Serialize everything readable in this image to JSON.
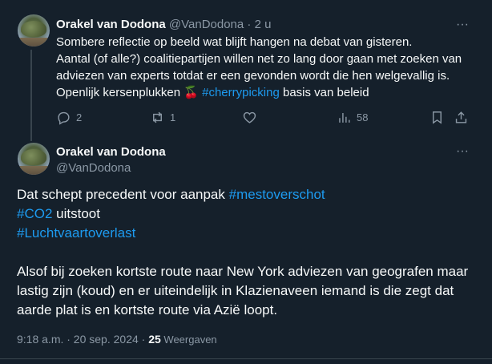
{
  "tweet1": {
    "name": "Orakel van Dodona",
    "handle": "@VanDodona",
    "separator": "·",
    "time": "2 u",
    "more_label": "···",
    "text_line1": "Sombere reflectie op beeld wat blijft hangen na debat van gisteren.",
    "text_line2": "Aantal (of alle?) coalitiepartijen willen net zo lang door gaan met zoeken van adviezen  van experts totdat er een gevonden wordt die hen welgevallig is.",
    "text_line3_pre": "Openlijk kersenplukken 🍒 ",
    "hashtag": "#cherrypicking",
    "text_line3_post": " basis van beleid",
    "replies": "2",
    "reposts": "1",
    "likes": "",
    "views": "58"
  },
  "tweet2": {
    "name": "Orakel van Dodona",
    "handle": "@VanDodona",
    "more_label": "···",
    "line1_pre": "Dat schept precedent voor aanpak ",
    "hashtag1": "#mestoverschot",
    "hashtag2": "#CO2",
    "line2_post": " uitstoot",
    "hashtag3": "#Luchtvaartoverlast",
    "paragraph2": "Alsof bij zoeken kortste route naar New York adviezen van geografen maar lastig zijn (koud) en er uiteindelijk in Klazienaveen iemand is die zegt dat aarde plat is en kortste route via Azië loopt.",
    "timestamp": "9:18 a.m. · 20 sep. 2024 · ",
    "views": "25",
    "views_label": " Weergaven"
  },
  "colors": {
    "background": "#15202b",
    "text": "#f7f9f9",
    "secondary": "#8b98a5",
    "link": "#1d9bf0",
    "border": "#38444d"
  }
}
